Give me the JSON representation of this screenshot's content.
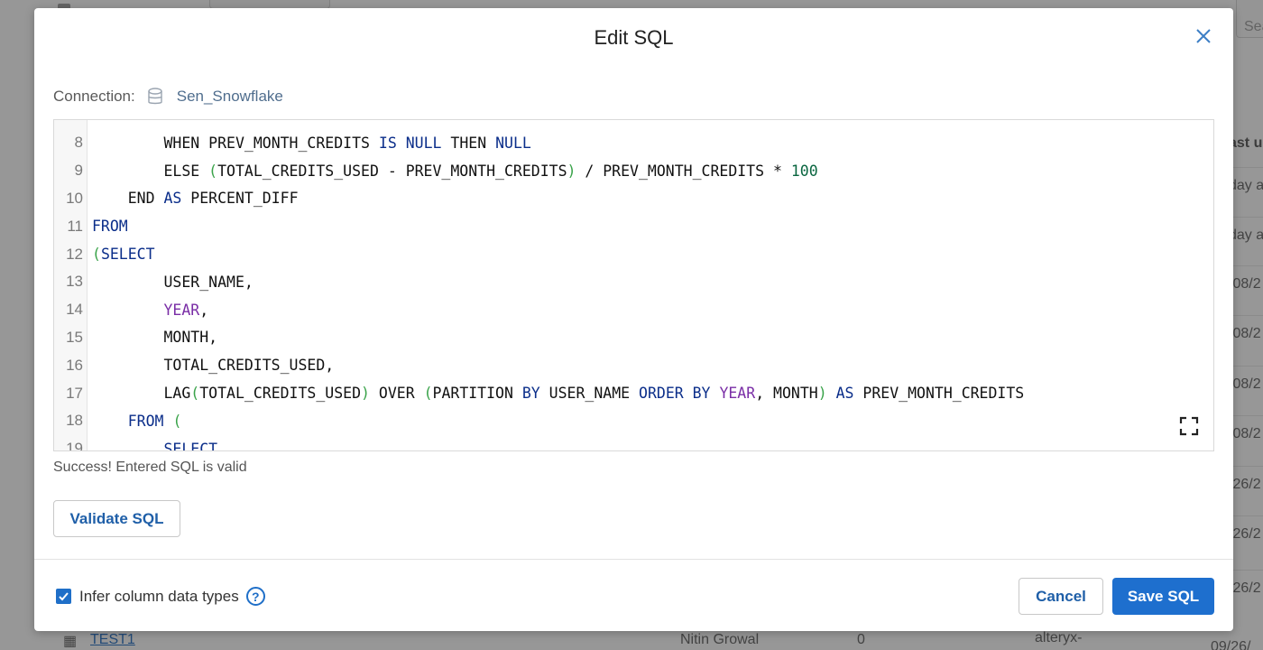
{
  "background": {
    "search_text": "Sea",
    "column_header": "ast u",
    "cells": [
      "day a",
      "day a",
      "/08/2",
      "/08/2",
      "/08/2",
      "/08/2",
      "/26/2",
      "/26/2",
      "/26/2"
    ],
    "bottom_row": {
      "name": "TEST1",
      "owner": "Nitin Growal",
      "count": "0",
      "source": "alteryx-",
      "date": "09/26/"
    }
  },
  "modal": {
    "title": "Edit SQL",
    "close_label": "×",
    "connection_label": "Connection:",
    "connection_name": "Sen_Snowflake",
    "status_message": "Success! Entered SQL is valid",
    "validate_label": "Validate SQL",
    "infer_label": "Infer column data types",
    "help_label": "?",
    "cancel_label": "Cancel",
    "save_label": "Save SQL"
  },
  "editor": {
    "lines": [
      {
        "n": "8",
        "tokens": [
          [
            "",
            "        "
          ],
          [
            "",
            "WHEN PREV_MONTH_CREDITS "
          ],
          [
            "kw",
            "IS"
          ],
          [
            "",
            " "
          ],
          [
            "kw",
            "NULL"
          ],
          [
            "",
            " THEN "
          ],
          [
            "kw",
            "NULL"
          ]
        ]
      },
      {
        "n": "9",
        "tokens": [
          [
            "",
            "        ELSE "
          ],
          [
            "par",
            "("
          ],
          [
            "",
            "TOTAL_CREDITS_USED - PREV_MONTH_CREDITS"
          ],
          [
            "par",
            ")"
          ],
          [
            "",
            " / PREV_MONTH_CREDITS * "
          ],
          [
            "num",
            "100"
          ]
        ]
      },
      {
        "n": "10",
        "tokens": [
          [
            "",
            "    END "
          ],
          [
            "kw",
            "AS"
          ],
          [
            "",
            " PERCENT_DIFF"
          ]
        ]
      },
      {
        "n": "11",
        "tokens": [
          [
            "kw",
            "FROM"
          ]
        ]
      },
      {
        "n": "12",
        "tokens": [
          [
            "par",
            "("
          ],
          [
            "kw",
            "SELECT"
          ]
        ]
      },
      {
        "n": "13",
        "tokens": [
          [
            "",
            "        USER_NAME,"
          ]
        ]
      },
      {
        "n": "14",
        "tokens": [
          [
            "",
            "        "
          ],
          [
            "fn",
            "YEAR"
          ],
          [
            "",
            ","
          ]
        ]
      },
      {
        "n": "15",
        "tokens": [
          [
            "",
            "        MONTH,"
          ]
        ]
      },
      {
        "n": "16",
        "tokens": [
          [
            "",
            "        TOTAL_CREDITS_USED,"
          ]
        ]
      },
      {
        "n": "17",
        "tokens": [
          [
            "",
            "        LAG"
          ],
          [
            "par",
            "("
          ],
          [
            "",
            "TOTAL_CREDITS_USED"
          ],
          [
            "par",
            ")"
          ],
          [
            "",
            " OVER "
          ],
          [
            "par",
            "("
          ],
          [
            "",
            "PARTITION "
          ],
          [
            "kw",
            "BY"
          ],
          [
            "",
            " USER_NAME "
          ],
          [
            "kw",
            "ORDER BY"
          ],
          [
            "",
            " "
          ],
          [
            "fn",
            "YEAR"
          ],
          [
            "",
            ", MONTH"
          ],
          [
            "par",
            ")"
          ],
          [
            "",
            " "
          ],
          [
            "kw",
            "AS"
          ],
          [
            "",
            " PREV_MONTH_CREDITS"
          ]
        ]
      },
      {
        "n": "18",
        "tokens": [
          [
            "",
            "    "
          ],
          [
            "kw",
            "FROM"
          ],
          [
            "",
            " "
          ],
          [
            "par",
            "("
          ]
        ]
      },
      {
        "n": "19",
        "tokens": [
          [
            "",
            "        "
          ],
          [
            "kw",
            "SELECT"
          ]
        ]
      }
    ]
  },
  "colors": {
    "accent": "#1e6fce",
    "keyword": "#0b2e8a",
    "function": "#7a2ea6",
    "number": "#0a6640",
    "paren": "#3aa34a"
  },
  "icons": {
    "close": "close-icon",
    "database": "database-icon",
    "expand": "fullscreen-icon",
    "check": "check-icon",
    "help": "help-icon"
  }
}
